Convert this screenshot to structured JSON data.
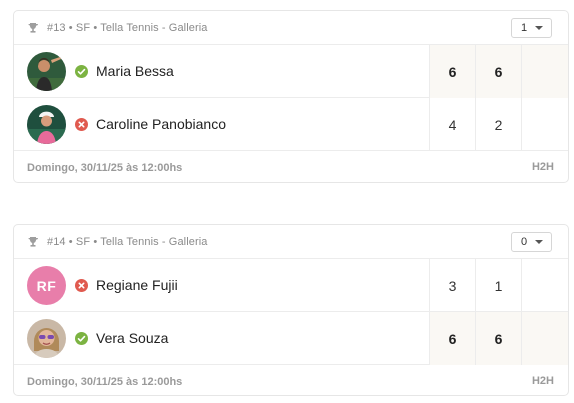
{
  "matches": [
    {
      "header": "#13 • SF • Tella Tennis - Galleria",
      "select_value": "1",
      "players": [
        {
          "name": "Maria Bessa",
          "status": "won",
          "avatar": "photo",
          "sets": [
            "6",
            "6"
          ],
          "winner": true
        },
        {
          "name": "Caroline Panobianco",
          "status": "lost",
          "avatar": "photo",
          "sets": [
            "4",
            "2"
          ],
          "winner": false
        }
      ],
      "date": "Domingo, 30/11/25 às 12:00hs",
      "h2h": "H2H"
    },
    {
      "header": "#14 • SF • Tella Tennis - Galleria",
      "select_value": "0",
      "players": [
        {
          "name": "Regiane Fujii",
          "status": "lost",
          "avatar": "initials",
          "initials": "RF",
          "sets": [
            "3",
            "1"
          ],
          "winner": false
        },
        {
          "name": "Vera Souza",
          "status": "won",
          "avatar": "photo",
          "sets": [
            "6",
            "6"
          ],
          "winner": true
        }
      ],
      "date": "Domingo, 30/11/25 às 12:00hs",
      "h2h": "H2H"
    }
  ],
  "colors": {
    "won": "#7cb342",
    "lost": "#e05a4f",
    "initials_bg": "#e87eaa"
  },
  "icons": {
    "header": "trophy-icon",
    "won": "check-circle-icon",
    "lost": "x-circle-icon",
    "select": "chevron-down-icon"
  }
}
